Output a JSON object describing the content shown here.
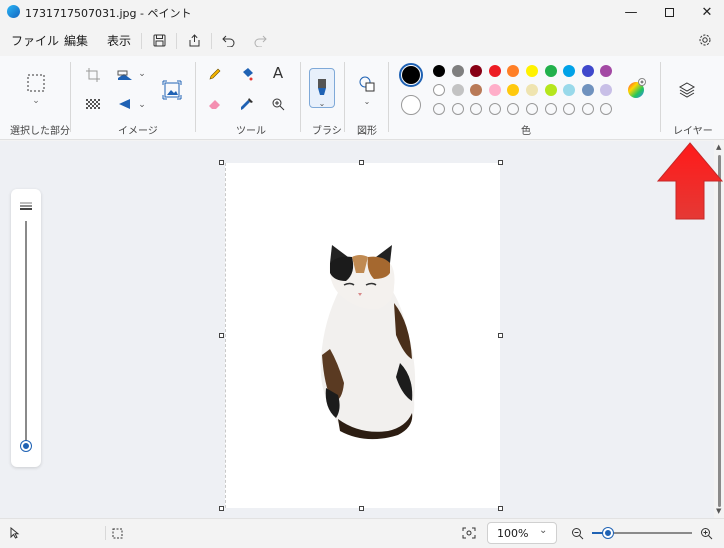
{
  "window": {
    "title": "1731717507031.jpg - ペイント",
    "minimize_icon": "minimize-icon",
    "maximize_icon": "maximize-icon",
    "close_icon": "close-icon"
  },
  "menu": {
    "file": "ファイル",
    "edit": "編集",
    "view": "表示",
    "save_icon": "save-icon",
    "share_icon": "share-icon",
    "undo_icon": "undo-icon",
    "redo_icon": "redo-icon",
    "settings_icon": "gear-icon"
  },
  "ribbon": {
    "groups": {
      "selection": "選択した部分",
      "image": "イメージ",
      "tools": "ツール",
      "brush": "ブラシ",
      "shapes": "図形",
      "color": "色",
      "layers": "レイヤー"
    }
  },
  "palette": {
    "current_primary": "#000000",
    "current_secondary": "#ffffff",
    "row1": [
      "#000000",
      "#7f7f7f",
      "#880015",
      "#ed1c24",
      "#ff7f27",
      "#fff200",
      "#22b14c",
      "#00a2e8",
      "#3f48cc",
      "#a349a4"
    ],
    "row2": [
      "#ffffff",
      "#c3c3c3",
      "#b97a57",
      "#ffaec9",
      "#ffc90e",
      "#efe4b0",
      "#b5e61d",
      "#99d9ea",
      "#7092be",
      "#c8bfe7"
    ],
    "row3_empty_count": 10
  },
  "status": {
    "zoom": "100%"
  },
  "canvas": {
    "image_description": "calico-cat-photo"
  }
}
